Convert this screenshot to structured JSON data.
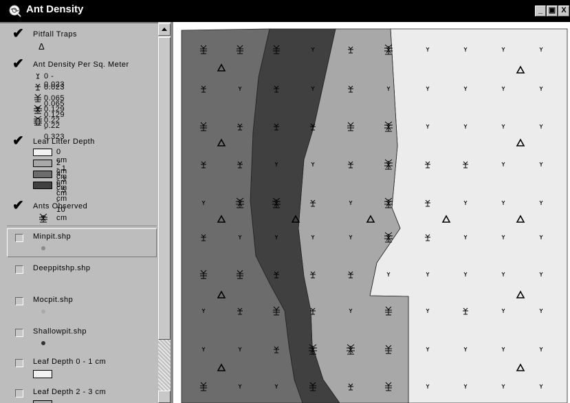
{
  "window": {
    "title": "Ant Density",
    "min_label": "_",
    "max_label": "▣",
    "close_label": "X"
  },
  "toc": {
    "pitfall": {
      "label": "Pitfall Traps",
      "checked": true,
      "symbol": "Δ"
    },
    "density": {
      "label": "Ant Density Per Sq. Meter",
      "checked": true,
      "classes": [
        {
          "range": "0 - 0.023"
        },
        {
          "range": "0.023 - 0.065"
        },
        {
          "range": "0.065 - 0.129"
        },
        {
          "range": "0.129 - 0.22"
        },
        {
          "range": "0.22 - 0.323"
        }
      ]
    },
    "litter": {
      "label": "Leaf Litter Depth",
      "checked": true,
      "classes": [
        {
          "range": "0 cm - 1 cm",
          "color": "#f1f1f1"
        },
        {
          "range": "2 cm - 3 cm",
          "color": "#a8a8a8"
        },
        {
          "range": "4 cm - 5 cm",
          "color": "#6c6c6c"
        },
        {
          "range": "6 cm - 10 cm",
          "color": "#404040"
        }
      ]
    },
    "observed": {
      "label": "Ants Observed",
      "checked": true
    },
    "minpit": {
      "label": "Minpit.shp",
      "checked": false,
      "dot_color": "#8a8a8a"
    },
    "deeppit": {
      "label": "Deeppitshp.shp",
      "checked": false,
      "dot_color": "#bdbdbd"
    },
    "mocpit": {
      "label": "Mocpit.shp",
      "checked": false,
      "dot_color": "#a9a9a9"
    },
    "shallow": {
      "label": "Shallowpit.shp",
      "checked": false,
      "dot_color": "#333333"
    },
    "depth01": {
      "label": "Leaf Depth 0 - 1 cm",
      "checked": false,
      "color": "#f1f1f1"
    },
    "depth23": {
      "label": "Leaf Depth 2 - 3 cm",
      "checked": false,
      "color": "#a8a8a8"
    }
  },
  "map": {
    "zone_colors": {
      "lightest": "#ececec",
      "light": "#a8a8a8",
      "medium": "#6c6c6c",
      "dark": "#404040"
    }
  }
}
